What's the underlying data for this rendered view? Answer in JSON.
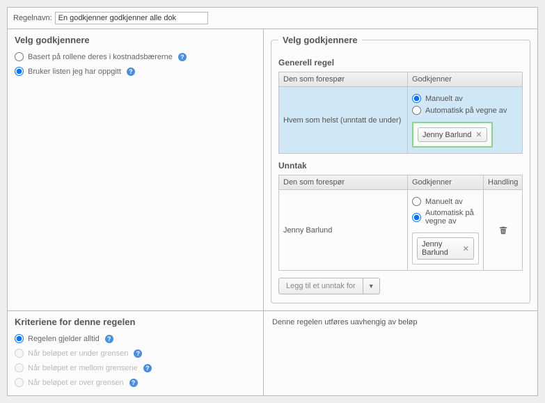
{
  "top": {
    "rule_name_label": "Regelnavn:",
    "rule_name_value": "En godkjenner godkjenner alle dok"
  },
  "left": {
    "title": "Velg godkjennere",
    "opt_roles": "Basert på rollene deres i kostnadsbærerne",
    "opt_list": "Bruker listen jeg har oppgitt"
  },
  "right": {
    "legend": "Velg godkjennere",
    "general_title": "Generell regel",
    "col_requester": "Den som forespør",
    "col_approver": "Godkjenner",
    "col_action": "Handling",
    "anyone_label": "Hvem som helst (unntatt de under)",
    "opt_manual": "Manuelt av",
    "opt_auto": "Automatisk på vegne av",
    "tag_name": "Jenny Barlund",
    "exceptions_title": "Unntak",
    "exc_requester": "Jenny Barlund",
    "add_exception_label": "Legg til et unntak for"
  },
  "bottom": {
    "title": "Kriteriene for denne regelen",
    "opt_always": "Regelen gjelder alltid",
    "opt_under": "Når beløpet er under grensen",
    "opt_between": "Når beløpet er mellom grensene",
    "opt_over": "Når beløpet er over grensen",
    "right_text": "Denne regelen utføres uavhengig av beløp"
  }
}
